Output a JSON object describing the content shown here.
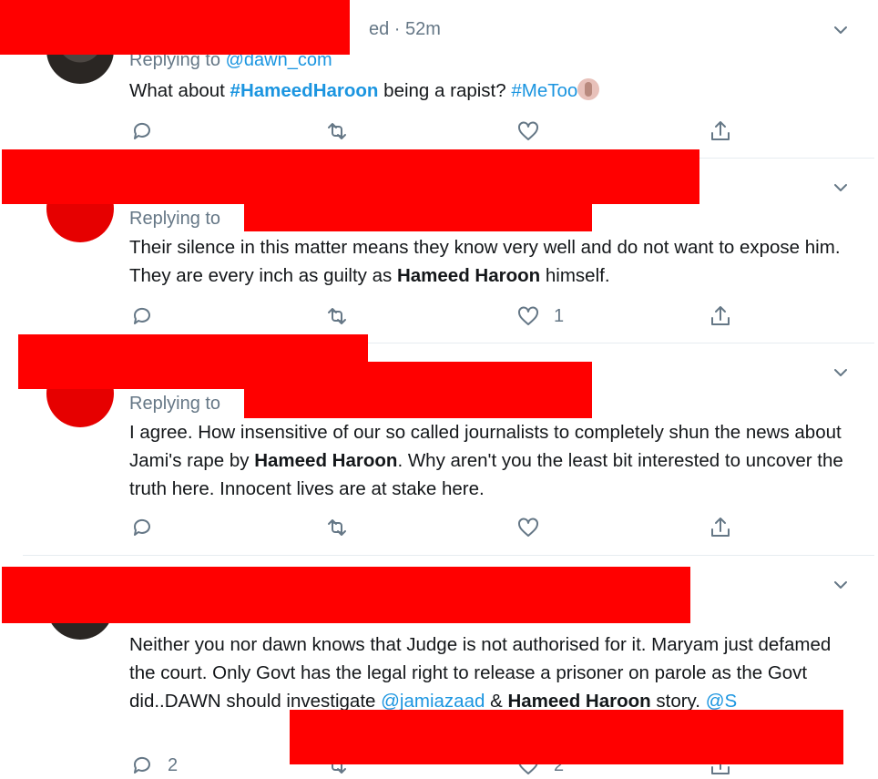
{
  "tweets": [
    {
      "time": "ed · 52m",
      "replying_prefix": "Replying to ",
      "replying_handle": "@dawn_com",
      "text_parts": [
        "What about ",
        "#HameedHaroon",
        " being a rapist? ",
        "#MeToo"
      ],
      "counts": {
        "reply": "",
        "retweet": "",
        "like": ""
      }
    },
    {
      "replying_prefix": "Replying to",
      "text_parts": [
        "Their silence in this matter means they know very well and do not want to expose him. They are every inch as guilty as ",
        "Hameed Haroon",
        " himself."
      ],
      "counts": {
        "reply": "",
        "retweet": "",
        "like": "1"
      }
    },
    {
      "replying_prefix": "Replying to",
      "text_parts": [
        "I agree. How insensitive of our so called journalists to completely shun the news about Jami's rape by ",
        "Hameed Haroon",
        ". Why aren't you the least bit interested to uncover the truth here. Innocent lives are at stake here."
      ],
      "counts": {
        "reply": "",
        "retweet": "",
        "like": ""
      }
    },
    {
      "text_parts": [
        "Neither you nor dawn knows that Judge is not authorised for it. Maryam just defamed the court. Only Govt has the legal right to release a prisoner on parole as the Govt did..DAWN should investigate ",
        "@jamiazaad",
        " & ",
        "Hameed Haroon",
        " story. ",
        "@S"
      ],
      "counts": {
        "reply": "2",
        "retweet": "",
        "like": "2"
      }
    }
  ],
  "icons": [
    "reply-icon",
    "retweet-icon",
    "like-icon",
    "share-icon",
    "chevron-down-icon"
  ],
  "colors": {
    "link": "#1b95e0",
    "muted": "#657786",
    "redaction": "#ff0000",
    "border": "#e6ecf0"
  }
}
